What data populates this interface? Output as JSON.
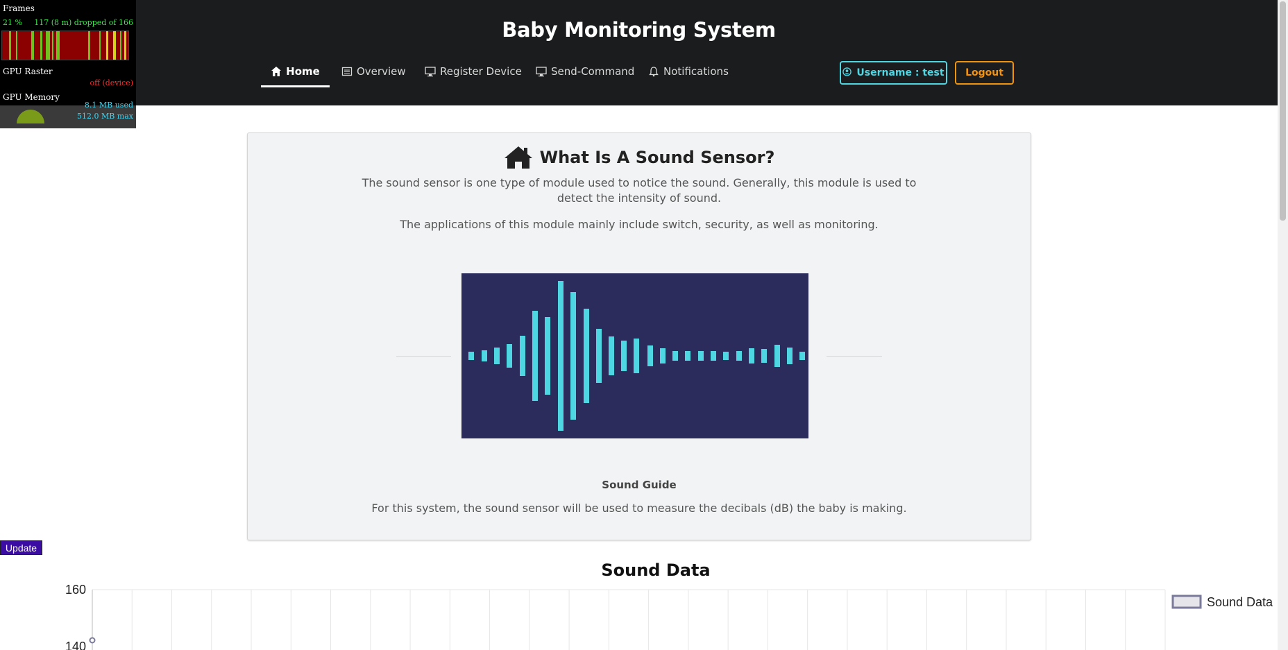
{
  "header": {
    "title": "Baby Monitoring System",
    "nav": [
      {
        "label": "Home",
        "icon": "home-icon",
        "active": true
      },
      {
        "label": "Overview",
        "icon": "list-icon",
        "active": false
      },
      {
        "label": "Register Device",
        "icon": "desktop-icon",
        "active": false
      },
      {
        "label": "Send-Command",
        "icon": "desktop-icon",
        "active": false
      },
      {
        "label": "Notifications",
        "icon": "bell-icon",
        "active": false
      }
    ],
    "user_label": "Username : test",
    "logout_label": "Logout"
  },
  "perf_overlay": {
    "frames_label": "Frames",
    "frames_percent": "21 %",
    "frames_stats": "117 (8 m) dropped of 166",
    "gpu_raster_label": "GPU Raster",
    "gpu_raster_status": "off (device)",
    "gpu_memory_label": "GPU Memory",
    "gpu_memory_used": "8.1 MB used",
    "gpu_memory_max": "512.0 MB max"
  },
  "card": {
    "title": "What Is A Sound Sensor?",
    "para1_line1": "The sound sensor is one type of module used to notice the sound. Generally, this module is used to",
    "para1_line2": "detect the intensity of sound.",
    "para2": "The applications of this module mainly include switch, security, as well as monitoring.",
    "image_caption": "Sound Guide",
    "para3": "For this system, the sound sensor will be used to measure the decibals (dB) the baby is making."
  },
  "update_label": "Update",
  "colors": {
    "header_bg": "#1b1c1d",
    "user_accent": "#4fd6e3",
    "logout_accent": "#f2930d",
    "update_bg": "#3c0da3",
    "wave_bg": "#2c2c5c",
    "wave_bar": "#4fd6e3"
  },
  "chart_data": {
    "type": "line",
    "title": "Sound Data",
    "series": [
      {
        "name": "Sound Data",
        "values": []
      }
    ],
    "y_ticks_visible": [
      160,
      140
    ],
    "ylim_visible": [
      140,
      160
    ],
    "grid": true,
    "legend": "top-right"
  }
}
